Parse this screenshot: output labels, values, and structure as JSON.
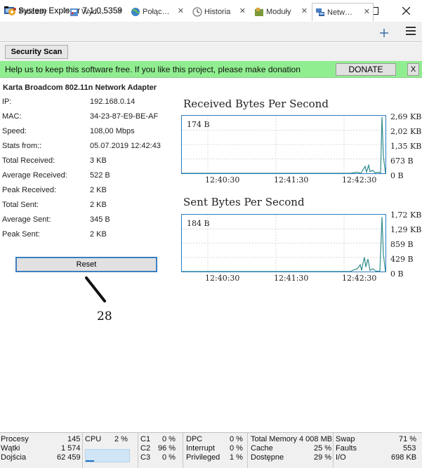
{
  "window": {
    "title": "System Explorer 7.1.0.5359"
  },
  "tabs": [
    {
      "label": "Procesy",
      "icon": "gear-icon",
      "active": false
    },
    {
      "label": "Wyd…",
      "icon": "event-icon",
      "active": false
    },
    {
      "label": "Połąc…",
      "icon": "globe-icon",
      "active": false
    },
    {
      "label": "Historia",
      "icon": "clock-icon",
      "active": false
    },
    {
      "label": "Moduły",
      "icon": "module-icon",
      "active": false
    },
    {
      "label": "Netw…",
      "icon": "network-icon",
      "active": true
    }
  ],
  "toolbar": {
    "security_scan_label": "Security Scan"
  },
  "donation": {
    "text": "Help us to keep this software free.  If you like this project, please make donation",
    "button_label": "DONATE",
    "close_label": "X"
  },
  "adapter": {
    "name": "Karta Broadcom 802.11n Network Adapter",
    "properties": [
      {
        "label": "IP:",
        "value": "192.168.0.14"
      },
      {
        "label": "MAC:",
        "value": "34-23-87-E9-BE-AF"
      },
      {
        "label": "Speed:",
        "value": "108,00 Mbps"
      },
      {
        "label": "Stats from::",
        "value": "05.07.2019 12:42:43"
      },
      {
        "label": "Total Received:",
        "value": "3 KB"
      },
      {
        "label": "Average Received:",
        "value": "522 B"
      },
      {
        "label": "Peak Received:",
        "value": "2 KB"
      },
      {
        "label": "Total Sent:",
        "value": "2 KB"
      },
      {
        "label": "Average Sent:",
        "value": "345 B"
      },
      {
        "label": "Peak Sent:",
        "value": "2 KB"
      }
    ],
    "reset_label": "Reset"
  },
  "annotation": {
    "number": "28"
  },
  "charts": {
    "received": {
      "title": "Received Bytes Per Second",
      "peak_label": "174 B",
      "y_labels": [
        "2,69 KB",
        "2,02 KB",
        "1,35 KB",
        "673 B",
        "0 B"
      ],
      "x_labels": [
        "12:40:30",
        "12:41:30",
        "12:42:30"
      ],
      "line_color": "#2e8b8b"
    },
    "sent": {
      "title": "Sent Bytes Per Second",
      "peak_label": "184 B",
      "y_labels": [
        "1,72 KB",
        "1,29 KB",
        "859 B",
        "429 B",
        "0 B"
      ],
      "x_labels": [
        "12:40:30",
        "12:41:30",
        "12:42:30"
      ],
      "line_color": "#2e8b8b"
    }
  },
  "statusbar": {
    "processes": {
      "label": "Procesy",
      "value": "145"
    },
    "threads": {
      "label": "Wątki",
      "value": "1 574"
    },
    "handles": {
      "label": "Dojścia",
      "value": "62 459"
    },
    "cpu": {
      "label": "CPU",
      "value": "2 %",
      "fraction": 0.02
    },
    "c1": {
      "label": "C1",
      "value": "0 %"
    },
    "c2": {
      "label": "C2",
      "value": "96 %"
    },
    "c3": {
      "label": "C3",
      "value": "0 %"
    },
    "dpc": {
      "label": "DPC",
      "value": "0 %"
    },
    "interrupt": {
      "label": "Interrupt",
      "value": "0 %"
    },
    "privileged": {
      "label": "Privileged",
      "value": "1 %"
    },
    "total_memory": {
      "label": "Total Memory",
      "value": "4 008 MB"
    },
    "cache": {
      "label": "Cache",
      "value": "25 %"
    },
    "available": {
      "label": "Dostępne",
      "value": "29 %"
    },
    "swap": {
      "label": "Swap",
      "value": "71 %"
    },
    "faults": {
      "label": "Faults",
      "value": "553"
    },
    "io": {
      "label": "I/O",
      "value": "698 KB"
    }
  }
}
